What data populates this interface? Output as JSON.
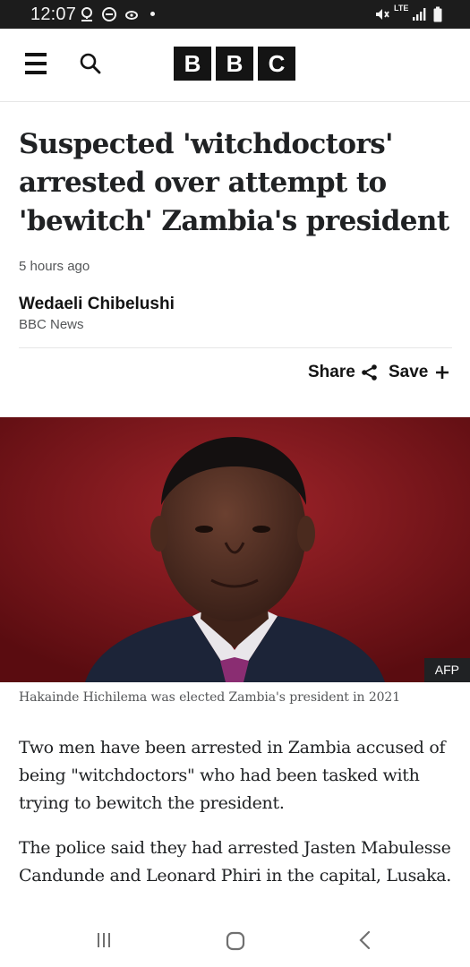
{
  "status_bar": {
    "time": "12:07",
    "network": "LTE",
    "icons": [
      "location-pin-icon",
      "do-not-disturb-icon",
      "link-icon",
      "notification-dot",
      "mute-icon",
      "signal-icon",
      "battery-icon"
    ]
  },
  "header": {
    "logo_letters": [
      "B",
      "B",
      "C"
    ],
    "icons": [
      "menu-icon",
      "search-icon"
    ]
  },
  "article": {
    "headline": "Suspected 'witchdoctors' arrested over attempt to 'bewitch' Zambia's president",
    "timestamp": "5 hours ago",
    "author": "Wedaeli Chibelushi",
    "organisation": "BBC News",
    "share_label": "Share",
    "save_label": "Save",
    "image_credit": "AFP",
    "image_caption": "Hakainde Hichilema was elected Zambia's president in 2021",
    "paragraphs": [
      "Two men have been arrested in Zambia accused of being \"witchdoctors\" who had been tasked with trying to bewitch the president.",
      "The police said they had arrested Jasten Mabulesse Candunde and Leonard Phiri in the capital, Lusaka."
    ]
  },
  "nav_bar": {
    "buttons": [
      "recents-button",
      "home-button",
      "back-button"
    ]
  },
  "colors": {
    "status_bar_bg": "#1c1c1c",
    "text_primary": "#202224",
    "text_secondary": "#545658",
    "logo_bg": "#141414",
    "photo_background": "#8a1a1e"
  }
}
